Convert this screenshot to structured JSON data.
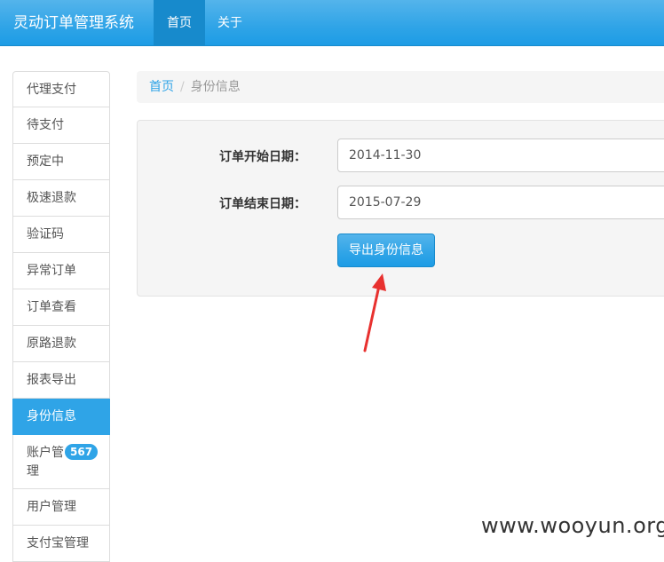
{
  "header": {
    "brand": "灵动订单管理系统",
    "nav": [
      {
        "label": "首页"
      },
      {
        "label": "关于"
      }
    ]
  },
  "sidebar": {
    "items": [
      {
        "label": "代理支付"
      },
      {
        "label": "待支付"
      },
      {
        "label": "预定中"
      },
      {
        "label": "极速退款"
      },
      {
        "label": "验证码"
      },
      {
        "label": "异常订单"
      },
      {
        "label": "订单查看"
      },
      {
        "label": "原路退款"
      },
      {
        "label": "报表导出"
      },
      {
        "label": "身份信息"
      },
      {
        "label": "账户管理",
        "badge": "567"
      },
      {
        "label": "用户管理"
      },
      {
        "label": "支付宝管理"
      }
    ]
  },
  "breadcrumb": {
    "home": "首页",
    "separator": "/",
    "current": "身份信息"
  },
  "form": {
    "start_label": "订单开始日期：",
    "start_value": "2014-11-30",
    "end_label": "订单结束日期：",
    "end_value": "2015-07-29",
    "export_button": "导出身份信息"
  },
  "watermark": "www.wooyun.org",
  "colors": {
    "primary": "#2fa4e7",
    "arrow": "#e8312f"
  }
}
